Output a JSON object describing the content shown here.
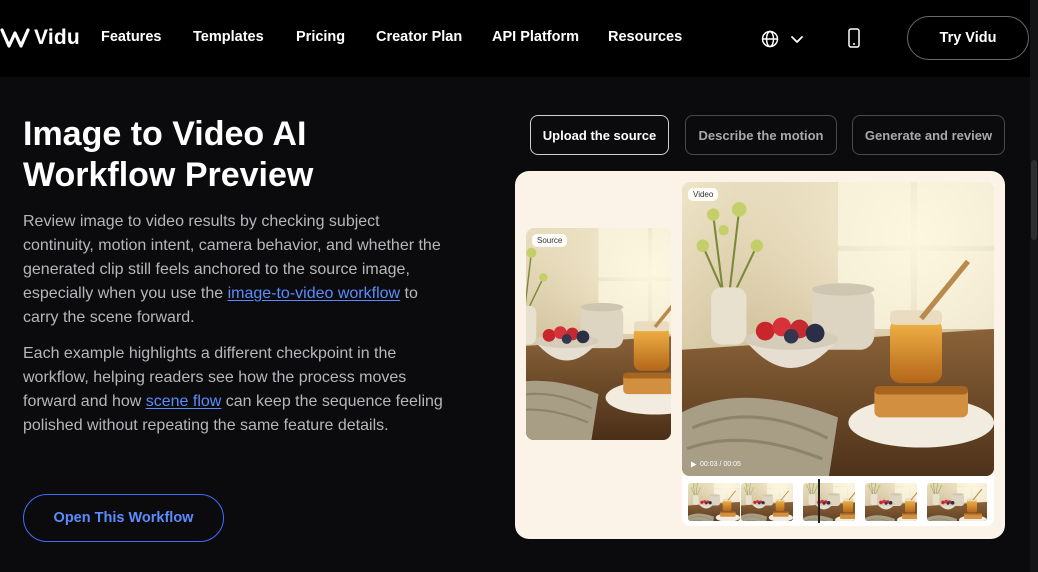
{
  "nav": {
    "logo_text": "Vidu",
    "links": [
      "Features",
      "Templates",
      "Pricing",
      "Creator Plan",
      "API Platform",
      "Resources"
    ],
    "language_icon": "globe-icon",
    "device_icon": "phone-icon",
    "cta_label": "Try Vidu"
  },
  "hero": {
    "title": "Image to Video AI Workflow Preview",
    "para1": {
      "before": "Review image to video results by checking subject continuity, motion intent, camera behavior, and whether the generated clip still feels anchored to the source image, especially when you use the ",
      "link": "image-to-video workflow",
      "after": " to carry the scene forward."
    },
    "para2": {
      "before": "Each example highlights a different checkpoint in the workflow, helping readers see how the process moves forward and how ",
      "link": "scene flow",
      "after": " can keep the sequence feeling polished without repeating the same feature details."
    },
    "button_label": "Open This Workflow"
  },
  "steps": [
    "Upload the source",
    "Describe the motion",
    "Generate and review"
  ],
  "preview": {
    "source_tag": "Source",
    "video_tag": "Video",
    "timecode": "00:03 / 00:05"
  },
  "colors": {
    "background": "#0b0b0d",
    "accent_link": "#5b8cff",
    "card_background": "#fbf3e7"
  }
}
